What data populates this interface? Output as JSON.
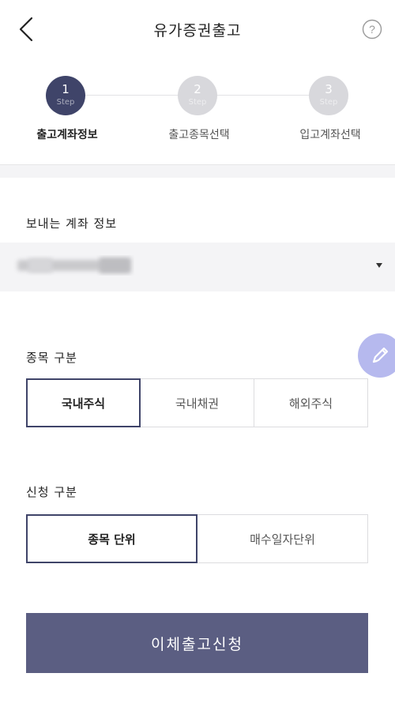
{
  "header": {
    "title": "유가증권출고"
  },
  "stepper": {
    "steps": [
      {
        "number": "1",
        "step_label": "Step",
        "title": "출고계좌정보",
        "state": "active"
      },
      {
        "number": "2",
        "step_label": "Step",
        "title": "출고종목선택",
        "state": "inactive"
      },
      {
        "number": "3",
        "step_label": "Step",
        "title": "입고계좌선택",
        "state": "inactive"
      }
    ]
  },
  "account": {
    "label": "보내는 계좌 정보"
  },
  "item_type": {
    "label": "종목 구분",
    "options": [
      "국내주식",
      "국내채권",
      "해외주식"
    ],
    "selected": "국내주식"
  },
  "request_type": {
    "label": "신청 구분",
    "options": [
      "종목 단위",
      "매수일자단위"
    ],
    "selected": "종목 단위"
  },
  "cta": {
    "label": "이체출고신청"
  },
  "colors": {
    "primary_dark": "#3f4469",
    "cta_bg": "#5b5e82",
    "fab_bg": "#b6b9ee"
  }
}
